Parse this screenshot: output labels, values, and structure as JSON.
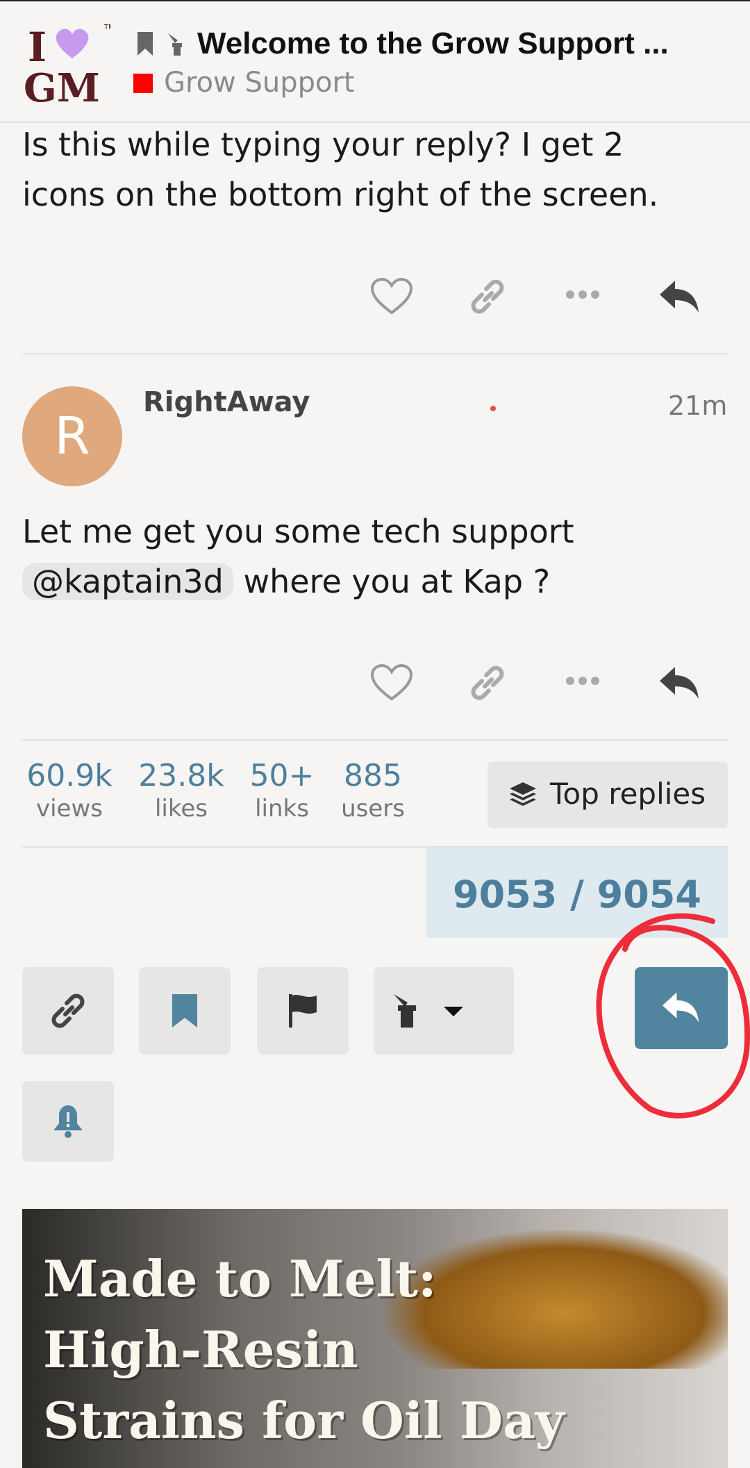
{
  "header": {
    "logo_text": "GM",
    "title": "Welcome to the Grow Support ...",
    "category": "Grow Support",
    "category_color": "#ff0000"
  },
  "posts": [
    {
      "text_line1": "Is this while typing your reply? I get 2",
      "text_line2": "icons on the bottom right of the screen."
    },
    {
      "avatar_letter": "R",
      "avatar_color": "#e0a97d",
      "username": "RightAway",
      "time": "21m",
      "text_line1": "Let me get you some tech support",
      "mention": "@kaptain3d",
      "text_line2_rest": " where you at Kap ?"
    }
  ],
  "post_actions": [
    "heart-icon",
    "link-icon",
    "more-icon",
    "reply-icon"
  ],
  "stats": {
    "views": {
      "num": "60.9k",
      "label": "views"
    },
    "likes": {
      "num": "23.8k",
      "label": "likes"
    },
    "links": {
      "num": "50+",
      "label": "links"
    },
    "users": {
      "num": "885",
      "label": "users"
    }
  },
  "top_replies_label": "Top replies",
  "progress": {
    "text": "9053 / 9054"
  },
  "footer_buttons": [
    "link-icon",
    "bookmark-icon",
    "flag-icon",
    "admin-wrench-icon",
    "reply-icon",
    "bell-icon"
  ],
  "accent_color": "#51859f",
  "ad": {
    "line1": "Made to Melt:",
    "line2": "High-Resin",
    "line3": "Strains for Oil Day"
  }
}
